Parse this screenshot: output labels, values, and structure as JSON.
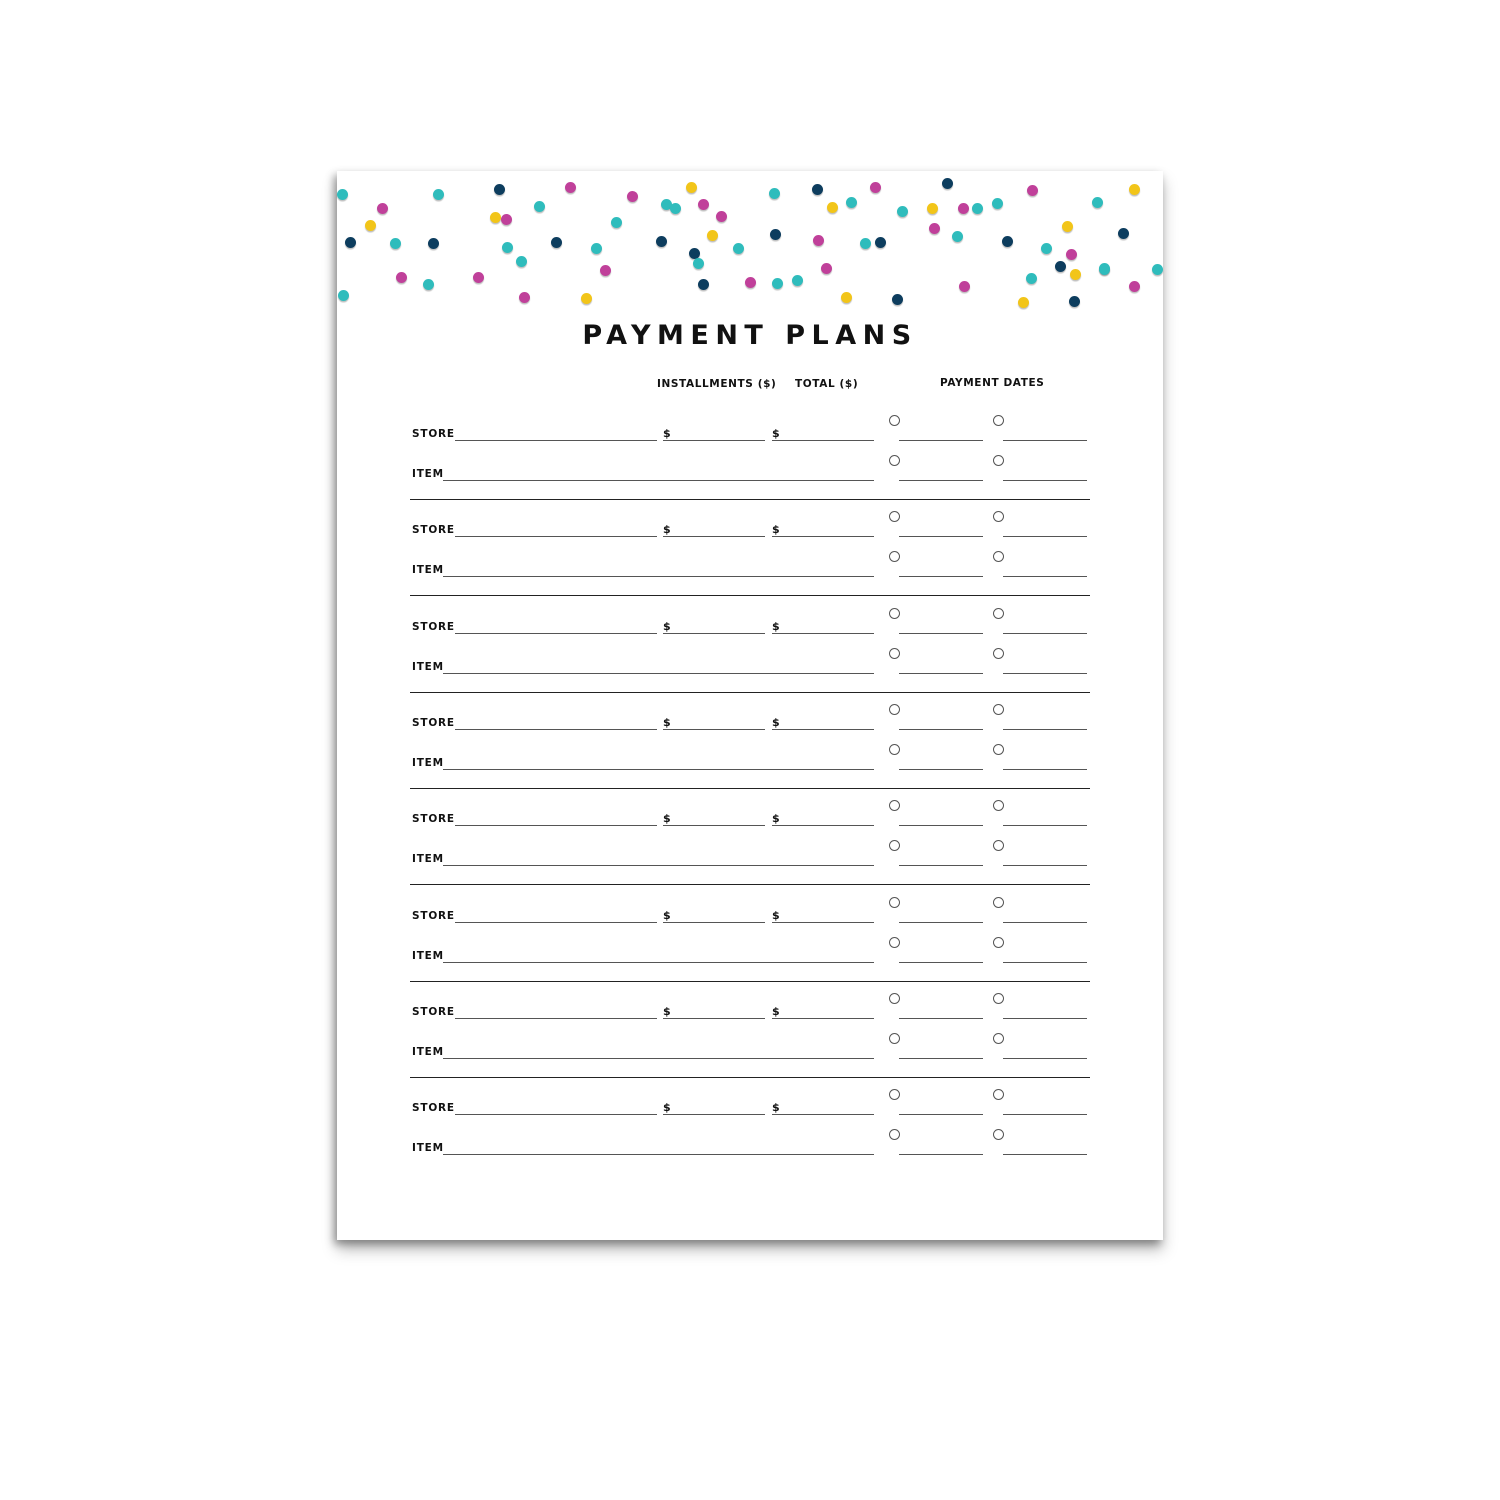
{
  "document": {
    "title": "PAYMENT PLANS",
    "columns": {
      "installments": "INSTALLMENTS ($)",
      "total": "TOTAL ($)",
      "payment_dates": "PAYMENT DATES"
    },
    "labels": {
      "store": "STORE",
      "item": "ITEM",
      "currency": "$"
    },
    "entries": [
      {
        "store": "",
        "item": "",
        "installments": "",
        "total": "",
        "dates": [
          "",
          "",
          "",
          ""
        ]
      },
      {
        "store": "",
        "item": "",
        "installments": "",
        "total": "",
        "dates": [
          "",
          "",
          "",
          ""
        ]
      },
      {
        "store": "",
        "item": "",
        "installments": "",
        "total": "",
        "dates": [
          "",
          "",
          "",
          ""
        ]
      },
      {
        "store": "",
        "item": "",
        "installments": "",
        "total": "",
        "dates": [
          "",
          "",
          "",
          ""
        ]
      },
      {
        "store": "",
        "item": "",
        "installments": "",
        "total": "",
        "dates": [
          "",
          "",
          "",
          ""
        ]
      },
      {
        "store": "",
        "item": "",
        "installments": "",
        "total": "",
        "dates": [
          "",
          "",
          "",
          ""
        ]
      },
      {
        "store": "",
        "item": "",
        "installments": "",
        "total": "",
        "dates": [
          "",
          "",
          "",
          ""
        ]
      },
      {
        "store": "",
        "item": "",
        "installments": "",
        "total": "",
        "dates": [
          "",
          "",
          "",
          ""
        ]
      }
    ]
  },
  "theme": {
    "confetti_colors": {
      "teal": "#2fbcbc",
      "navy": "#0d3d5e",
      "magenta": "#c0409a",
      "yellow": "#f2c519"
    },
    "ink": "#111111"
  }
}
